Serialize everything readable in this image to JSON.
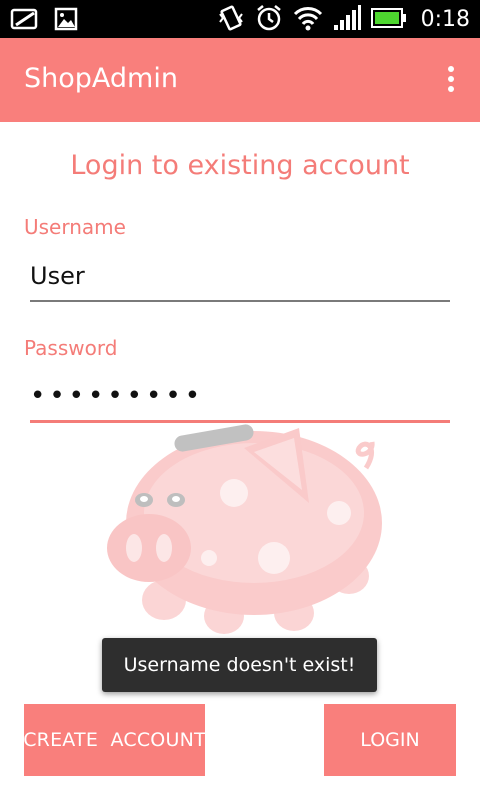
{
  "status_bar": {
    "left_icons": [
      "whatsapp-icon",
      "image-icon"
    ],
    "right_icons": [
      "vibrate-icon",
      "alarm-icon",
      "wifi-icon",
      "signal-icon",
      "battery-icon"
    ],
    "time": "0:18"
  },
  "action_bar": {
    "title": "ShopAdmin",
    "overflow_icon": "overflow-menu-icon",
    "color": "#f97f7c"
  },
  "login": {
    "heading": "Login to existing account",
    "username_label": "Username",
    "username_value": "User",
    "password_label": "Password",
    "password_value": "•••••••••",
    "accent_color": "#f47c78"
  },
  "illustration": "piggy-bank-icon",
  "toast": {
    "message": "Username doesn't exist!"
  },
  "buttons": {
    "create_account": "CREATE  ACCOUNT",
    "login": "LOGIN"
  }
}
